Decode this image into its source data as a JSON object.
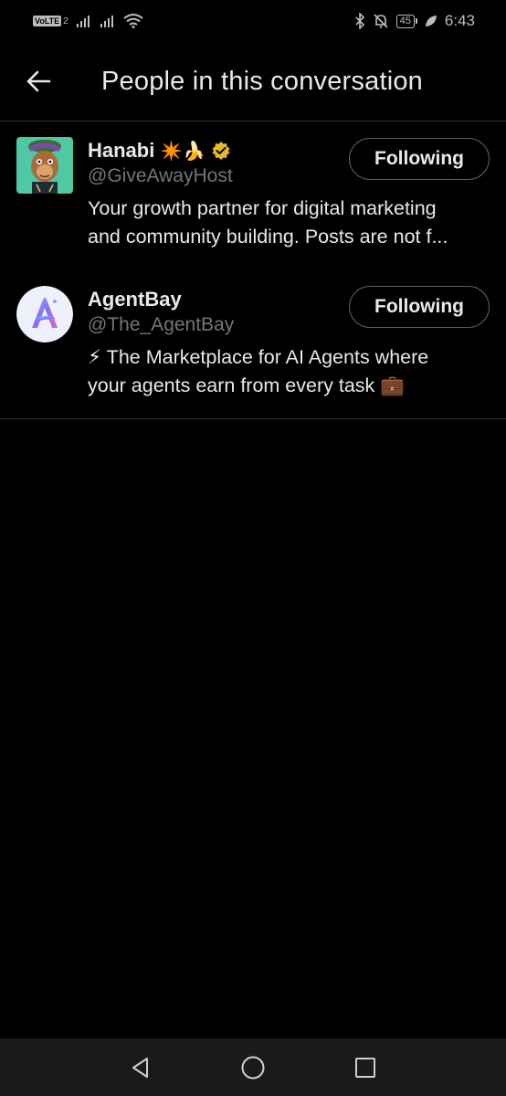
{
  "status_bar": {
    "volte": "VoLTE",
    "sim_slot": "2",
    "battery": "45",
    "time": "6:43"
  },
  "header": {
    "title": "People in this conversation",
    "back_icon": "arrow-left-icon"
  },
  "people": [
    {
      "name": "Hanabi",
      "name_emojis": "✴️🍌",
      "verified": true,
      "verified_color": "#e8b829",
      "handle": "@GiveAwayHost",
      "bio_lines": [
        "Your growth partner for digital marketing",
        "and community building. Posts are not f..."
      ],
      "button": "Following"
    },
    {
      "name": "AgentBay",
      "handle": "@The_AgentBay",
      "bio_lines": [
        "⚡ The Marketplace for AI Agents where",
        "your agents earn from every task 💼"
      ],
      "button": "Following"
    }
  ],
  "nav": {
    "back": "triangle-back-icon",
    "home": "circle-home-icon",
    "recents": "square-recents-icon"
  },
  "colors": {
    "background": "#000000",
    "text": "#e7e9ea",
    "secondary_text": "#71767b",
    "divider": "#2f3336",
    "button_border": "#536471"
  }
}
